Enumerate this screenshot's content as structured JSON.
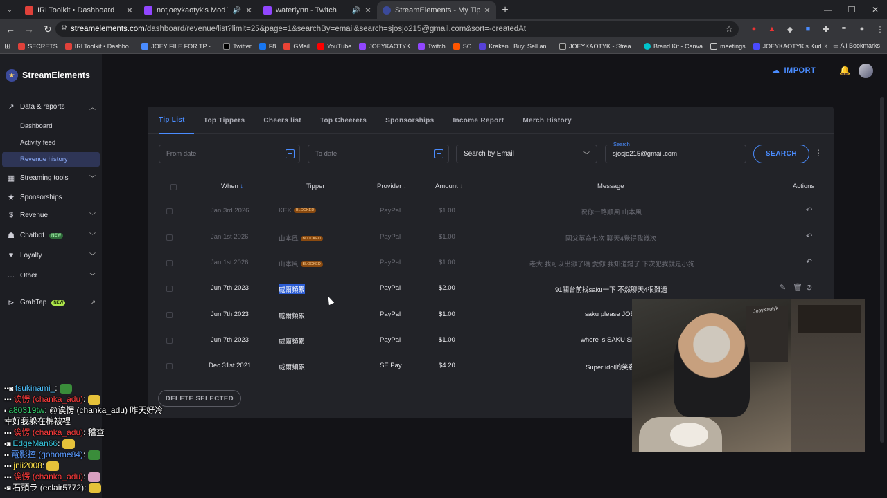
{
  "browser": {
    "tabs": [
      {
        "title": "IRLToolkit • Dashboard",
        "color": "#e0413a",
        "has_audio": false
      },
      {
        "title": "notjoeykaotyk's Mod View",
        "color": "#9146ff",
        "has_audio": true
      },
      {
        "title": "waterlynn - Twitch",
        "color": "#9146ff",
        "has_audio": true
      },
      {
        "title": "StreamElements - My Tips",
        "color": "#3b4a9a",
        "has_audio": false
      }
    ],
    "url_host": "streamelements.com",
    "url_path": "/dashboard/revenue/list?limit=25&page=1&searchBy=email&search=sjosjo215@gmail.com&sort=-createdAt",
    "bookmarks": [
      "SECRETS",
      "IRLToolkit • Dashbo...",
      "JOEY FILE FOR TP -...",
      "Twitter",
      "F8",
      "GMail",
      "YouTube",
      "JOEYKAOTYK",
      "Twitch",
      "SC",
      "Kraken | Buy, Sell an...",
      "JOEYKAOTYK - Strea...",
      "Brand Kit - Canva",
      "meetings",
      "JOEYKAOTYK's Kud..."
    ],
    "all_bookmarks": "All Bookmarks"
  },
  "app": {
    "brand": "StreamElements",
    "import_label": "IMPORT",
    "sidebar": {
      "data_reports": "Data & reports",
      "dashboard": "Dashboard",
      "activity_feed": "Activity feed",
      "revenue_history": "Revenue history",
      "streaming_tools": "Streaming tools",
      "sponsorships": "Sponsorships",
      "revenue": "Revenue",
      "chatbot": "Chatbot",
      "chatbot_badge": "NEW",
      "loyalty": "Loyalty",
      "other": "Other",
      "grabtap": "GrabTap",
      "grabtap_badge": "NEW"
    },
    "tabs": [
      "Tip List",
      "Top Tippers",
      "Cheers list",
      "Top Cheerers",
      "Sponsorships",
      "Income Report",
      "Merch History"
    ],
    "filters": {
      "from_date": "From date",
      "to_date": "To date",
      "search_by": "Search by Email",
      "search_label": "Search",
      "search_value": "sjosjo215@gmail.com",
      "search_button": "SEARCH"
    },
    "columns": {
      "when": "When",
      "tipper": "Tipper",
      "provider": "Provider",
      "amount": "Amount",
      "message": "Message",
      "actions": "Actions"
    },
    "rows": [
      {
        "when": "Jan 3rd 2026",
        "tipper": "KEK",
        "blocked": "BLOCKED",
        "provider": "PayPal",
        "amount": "$1.00",
        "message": "祝你一路順風 山本風"
      },
      {
        "when": "Jan 1st 2026",
        "tipper": "山本風",
        "blocked": "BLOCKED",
        "provider": "PayPal",
        "amount": "$1.00",
        "message": "國父革命七次 聊天4覺得我幾次"
      },
      {
        "when": "Jan 1st 2026",
        "tipper": "山本風",
        "blocked": "BLOCKED",
        "provider": "PayPal",
        "amount": "$1.00",
        "message": "老大 我可以出獄了嗎 愛你 我知道錯了 下次犯我就是小狗"
      },
      {
        "when": "Jun 7th 2023",
        "tipper": "威爾頻累",
        "provider": "PayPal",
        "amount": "$2.00",
        "message": "91關台前找saku一下 不然聊天4很難過"
      },
      {
        "when": "Jun 7th 2023",
        "tipper": "威爾頻累",
        "provider": "PayPal",
        "amount": "$1.00",
        "message": "saku please JOE"
      },
      {
        "when": "Jun 7th 2023",
        "tipper": "威爾頻累",
        "provider": "PayPal",
        "amount": "$1.00",
        "message": "where is SAKU SI"
      },
      {
        "when": "Dec 31st 2021",
        "tipper": "威爾頻累",
        "provider": "SE.Pay",
        "amount": "$4.20",
        "message": "Super idol的笑容"
      }
    ],
    "delete_selected": "DELETE SELECTED"
  },
  "chat": [
    {
      "user": "tsukinami_",
      "msg": ":"
    },
    {
      "user": "诶愣 (chanka_adu)",
      "msg": ":"
    },
    {
      "user": "a80319tw",
      "msg": ": @诶愣 (chanka_adu) 昨天好冷"
    },
    {
      "user": "",
      "msg": "幸好我躲在棉被裡"
    },
    {
      "user": "诶愣 (chanka_adu)",
      "msg": ": 稽查"
    },
    {
      "user": "EdgeMan66",
      "msg": ":"
    },
    {
      "user": "電影控 (gohome84)",
      "msg": ":"
    },
    {
      "user": "jnii2008",
      "msg": ":"
    },
    {
      "user": "诶愣 (chanka_adu)",
      "msg": ":"
    },
    {
      "user": "石頭ラ (eclair5772)",
      "msg": ":"
    }
  ],
  "webcam_label": "JoeyKaotyk",
  "colors": {
    "accent": "#4a8cff",
    "blocked_badge": "#8a4a10",
    "sidebar_active": "#2e3556"
  }
}
